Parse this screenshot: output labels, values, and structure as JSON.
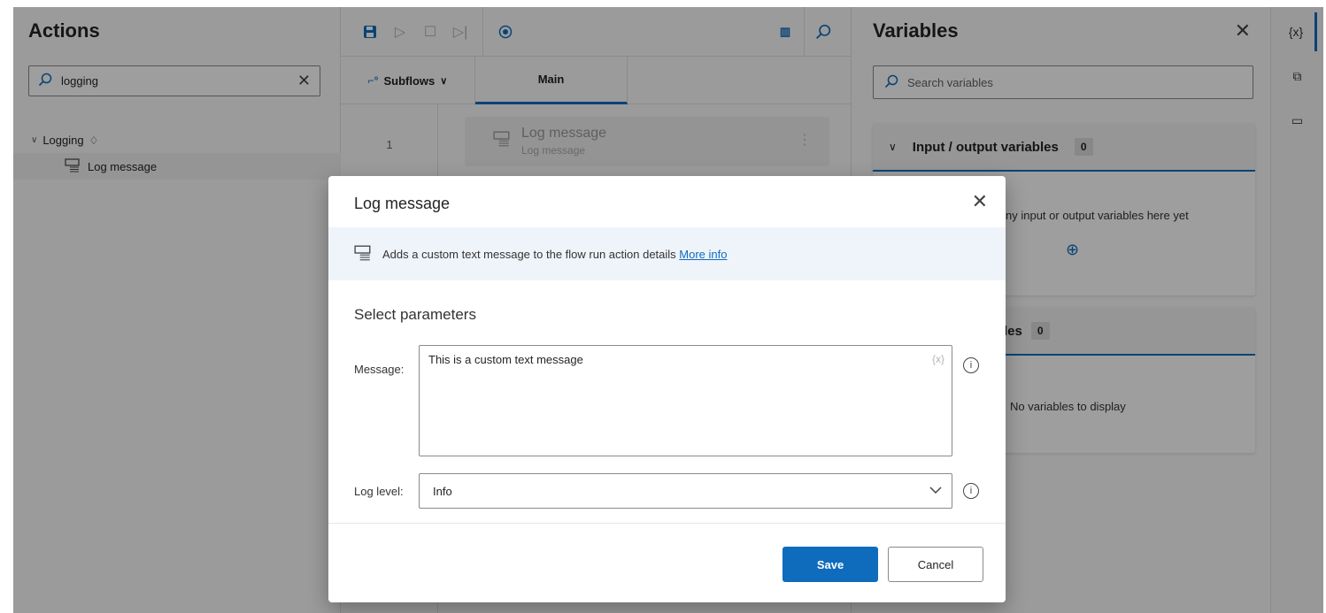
{
  "actions_pane": {
    "title": "Actions",
    "search_value": "logging",
    "group_label": "Logging",
    "item_label": "Log message"
  },
  "designer": {
    "subflows_label": "Subflows",
    "main_tab_label": "Main",
    "step": {
      "line_number": "1",
      "title": "Log message",
      "subtitle": "Log message"
    }
  },
  "variables_pane": {
    "title": "Variables",
    "search_placeholder": "Search variables",
    "io_section": {
      "title": "Input / output variables",
      "count": "0",
      "empty_text_partial": "ny input or output variables here yet"
    },
    "flow_section": {
      "title_partial": "les",
      "count": "0",
      "empty_text": "No variables to display"
    }
  },
  "rail": {
    "variables_label": "{x}"
  },
  "dialog": {
    "title": "Log message",
    "description": "Adds a custom text message to the flow run action details",
    "more_info_link": "More info",
    "section_title": "Select parameters",
    "message_label": "Message:",
    "message_value": "This is a custom text message",
    "variable_hint": "{x}",
    "log_level_label": "Log level:",
    "log_level_value": "Info",
    "save_label": "Save",
    "cancel_label": "Cancel"
  },
  "colors": {
    "accent": "#0f6cbd",
    "overlay": "#000000"
  }
}
